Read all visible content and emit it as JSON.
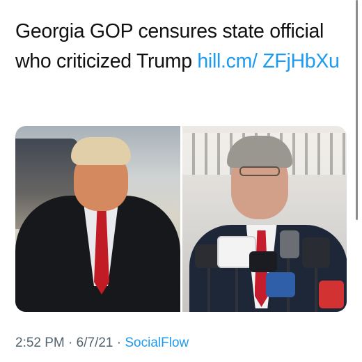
{
  "tweet": {
    "text": "Georgia GOP censures state official who criticized Trump ",
    "link": "hill.cm/ ZFjHbXu"
  },
  "media": {
    "left_photo": "photo",
    "right_photo": "photo"
  },
  "meta": {
    "time": "2:52 PM",
    "separator1": " · ",
    "date": "6/7/21",
    "separator2": " · ",
    "source": "SocialFlow"
  },
  "colors": {
    "link": "#1d9bf0",
    "text": "#111111",
    "meta": "#536471"
  }
}
